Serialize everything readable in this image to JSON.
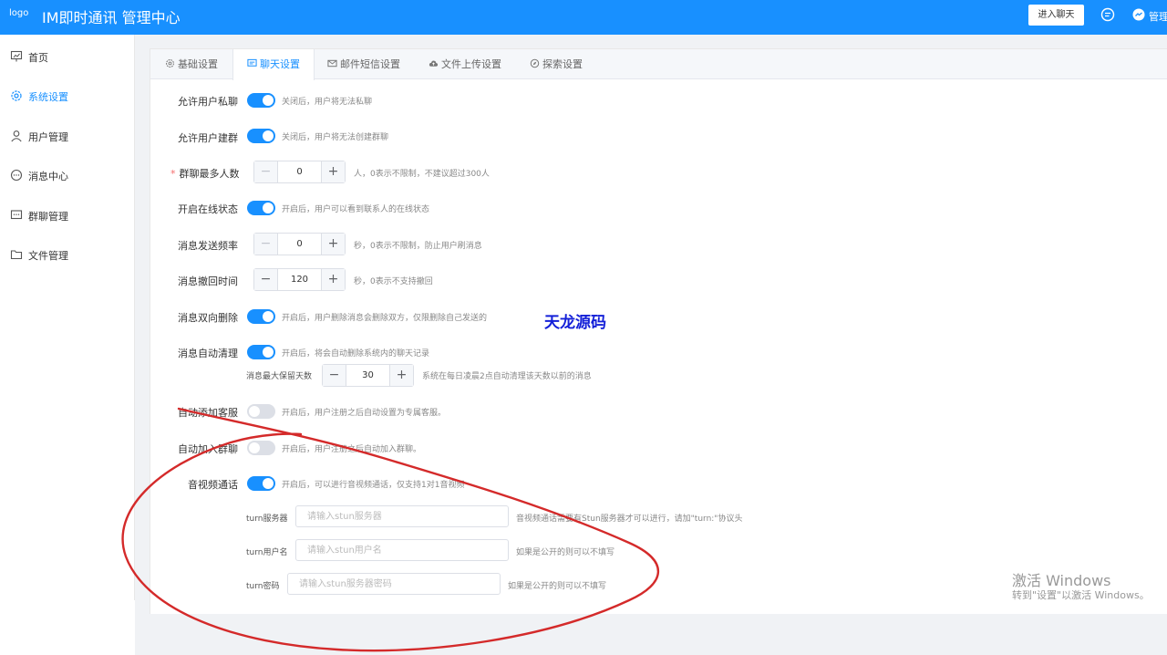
{
  "header": {
    "logo_alt": "logo",
    "title": "IM即时通讯 管理中心",
    "enter_chat": "进入聊天",
    "manage": "管理"
  },
  "sidebar": {
    "items": [
      {
        "label": "首页",
        "icon": "presentation-icon"
      },
      {
        "label": "系统设置",
        "icon": "gear-icon",
        "active": true
      },
      {
        "label": "用户管理",
        "icon": "user-icon"
      },
      {
        "label": "消息中心",
        "icon": "chat-bubble-icon"
      },
      {
        "label": "群聊管理",
        "icon": "group-chat-icon"
      },
      {
        "label": "文件管理",
        "icon": "folder-icon"
      }
    ]
  },
  "tabs": [
    {
      "label": "基础设置",
      "icon": "gear-icon"
    },
    {
      "label": "聊天设置",
      "icon": "chat-icon",
      "active": true
    },
    {
      "label": "邮件短信设置",
      "icon": "mail-icon"
    },
    {
      "label": "文件上传设置",
      "icon": "cloud-upload-icon"
    },
    {
      "label": "探索设置",
      "icon": "compass-icon"
    }
  ],
  "settings": {
    "private_chat": {
      "label": "允许用户私聊",
      "enabled": true,
      "hint": "关闭后，用户将无法私聊"
    },
    "create_group": {
      "label": "允许用户建群",
      "enabled": true,
      "hint": "关闭后，用户将无法创建群聊"
    },
    "group_max": {
      "label": "群聊最多人数",
      "required_mark": "*",
      "value": "0",
      "hint": "人，0表示不限制，不建议超过300人"
    },
    "online_status": {
      "label": "开启在线状态",
      "enabled": true,
      "hint": "开启后，用户可以看到联系人的在线状态"
    },
    "send_rate": {
      "label": "消息发送频率",
      "value": "0",
      "hint": "秒，0表示不限制，防止用户刷消息"
    },
    "recall_time": {
      "label": "消息撤回时间",
      "value": "120",
      "hint": "秒，0表示不支持撤回"
    },
    "two_way_delete": {
      "label": "消息双向删除",
      "enabled": true,
      "hint": "开启后，用户删除消息会删除双方，仅限删除自己发送的"
    },
    "auto_clean": {
      "label": "消息自动清理",
      "enabled": true,
      "hint": "开启后，将会自动删除系统内的聊天记录"
    },
    "retain_days": {
      "label": "消息最大保留天数",
      "value": "30",
      "hint": "系统在每日凌晨2点自动清理该天数以前的消息"
    },
    "auto_add_service": {
      "label": "自动添加客服",
      "enabled": false,
      "hint": "开启后，用户注册之后自动设置为专属客服。"
    },
    "auto_join_group": {
      "label": "自动加入群聊",
      "enabled": false,
      "hint": "开启后，用户注册之后自动加入群聊。"
    },
    "av_call": {
      "label": "音视频通话",
      "enabled": true,
      "hint": "开启后，可以进行音视频通话，仅支持1对1音视频"
    },
    "turn_server": {
      "label": "turn服务器",
      "value": "",
      "placeholder": "请输入stun服务器",
      "hint": "音视频通话需要有Stun服务器才可以进行，请加\"turn:\"协议头"
    },
    "turn_user": {
      "label": "turn用户名",
      "value": "",
      "placeholder": "请输入stun用户名",
      "hint": "如果是公开的则可以不填写"
    },
    "turn_password": {
      "label": "turn密码",
      "value": "",
      "placeholder": "请输入stun服务器密码",
      "hint": "如果是公开的则可以不填写"
    }
  },
  "watermark": "天龙源码",
  "activation": {
    "title": "激活 Windows",
    "subtitle": "转到\"设置\"以激活 Windows。"
  },
  "colors": {
    "primary": "#1890ff",
    "watermark": "#1420d8",
    "annotation": "#d42a2a"
  }
}
